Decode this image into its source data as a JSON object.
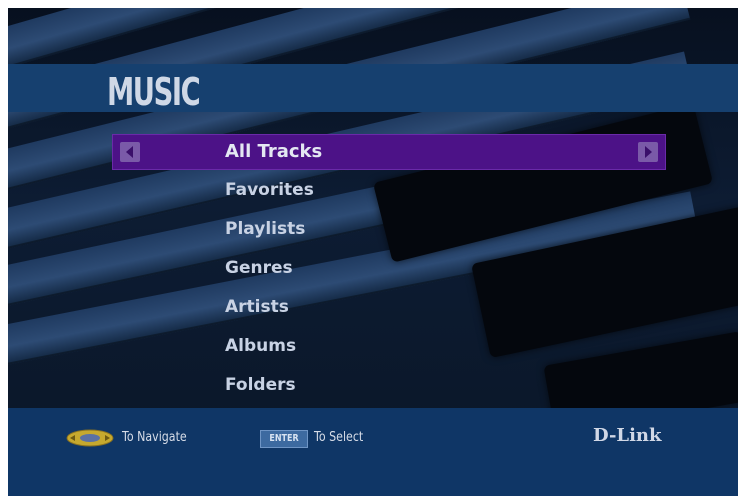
{
  "page": {
    "title": "MUSIC"
  },
  "menu": {
    "selected": "All Tracks",
    "items": [
      "Favorites",
      "Playlists",
      "Genres",
      "Artists",
      "Albums",
      "Folders"
    ]
  },
  "footer": {
    "navigate_label": "To Navigate",
    "enter_key_label": "ENTER",
    "select_label": "To Select",
    "brand": "D-Link"
  },
  "colors": {
    "title_bar": "#16406f",
    "selection": "#4c1287",
    "footer": "#0f3666"
  },
  "icons": [
    "navigation-pad-icon",
    "enter-key-icon",
    "left-arrow-icon",
    "right-arrow-icon"
  ]
}
